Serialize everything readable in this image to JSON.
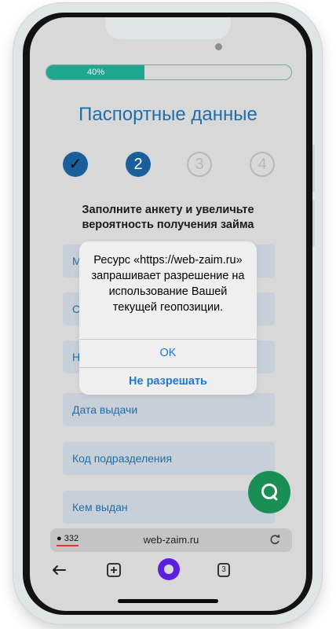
{
  "progress": {
    "label": "40%",
    "value": 0.4
  },
  "form": {
    "title": "Паспортные данные",
    "steps": [
      {
        "label": "✓",
        "state": "done"
      },
      {
        "label": "2",
        "state": "active"
      },
      {
        "label": "3",
        "state": "pending"
      },
      {
        "label": "4",
        "state": "pending"
      }
    ],
    "subtitle": "Заполните анкету и увеличьте вероятность получения займа",
    "fields": [
      {
        "label": "М"
      },
      {
        "label": "С"
      },
      {
        "label": "Н"
      },
      {
        "label": "Дата выдачи"
      },
      {
        "label": "Код подразделения"
      },
      {
        "label": "Кем выдан"
      }
    ]
  },
  "dialog": {
    "message": "Ресурс «https://web-zaim.ru» запрашивает разрешение на использование Вашей текущей геопозиции.",
    "ok_label": "OK",
    "deny_label": "Не разрешать"
  },
  "browser": {
    "url": "web-zaim.ru",
    "comments_count": "332",
    "tabs_count": "3"
  },
  "icons": {
    "chat": "chat-bubble-icon",
    "reload": "reload-icon",
    "back": "back-arrow-icon",
    "new_tab": "plus-square-icon",
    "assistant": "alice-icon",
    "tabs": "tabs-icon"
  },
  "colors": {
    "accent": "#1f6ea8",
    "progress": "#1ea88f",
    "fab": "#1a8f55",
    "dialog_button": "#1b7ad3",
    "assistant": "#5b1fe0"
  }
}
